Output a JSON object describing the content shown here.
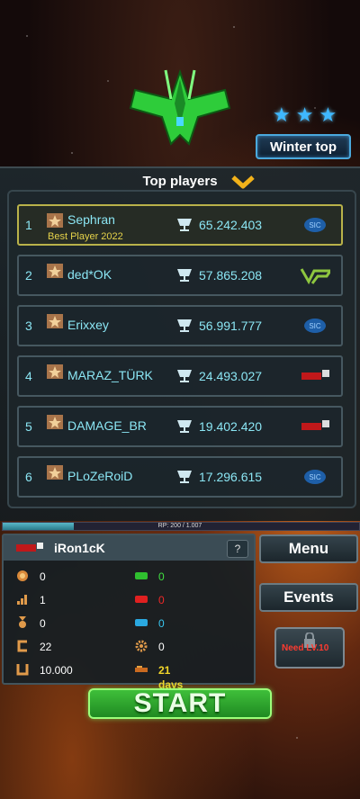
{
  "header": {
    "season_button": "Winter top",
    "stars_count": 3
  },
  "leaderboard": {
    "title": "Top players",
    "players": [
      {
        "rank": "1",
        "name": "Sephran",
        "subtitle": "Best Player 2022",
        "score": "65.242.403",
        "clan": "blue"
      },
      {
        "rank": "2",
        "name": "ded*OK",
        "subtitle": "",
        "score": "57.865.208",
        "clan": "green"
      },
      {
        "rank": "3",
        "name": "Erixxey",
        "subtitle": "",
        "score": "56.991.777",
        "clan": "blue"
      },
      {
        "rank": "4",
        "name": "MARAZ_TÜRK",
        "subtitle": "",
        "score": "24.493.027",
        "clan": "red"
      },
      {
        "rank": "5",
        "name": "DAMAGE_BR",
        "subtitle": "",
        "score": "19.402.420",
        "clan": "red"
      },
      {
        "rank": "6",
        "name": "PLoZeRoiD",
        "subtitle": "",
        "score": "17.296.615",
        "clan": "blue"
      }
    ]
  },
  "rp": {
    "text": "RP: 200 / 1.007",
    "fraction": 0.2
  },
  "profile": {
    "name": "iRon1cK",
    "help": "?",
    "stats_left": [
      "0",
      "1",
      "0",
      "22",
      "10.000"
    ],
    "stats_right": [
      "0",
      "0",
      "0",
      "0",
      "21 days"
    ]
  },
  "menu": {
    "menu_label": "Menu",
    "events_label": "Events",
    "need_label": "Need LV.10",
    "start_label": "START"
  },
  "colors": {
    "accent_cyan": "#8be6f4",
    "highlight_gold": "#b9b24a",
    "start_green": "#3fbf3a"
  }
}
